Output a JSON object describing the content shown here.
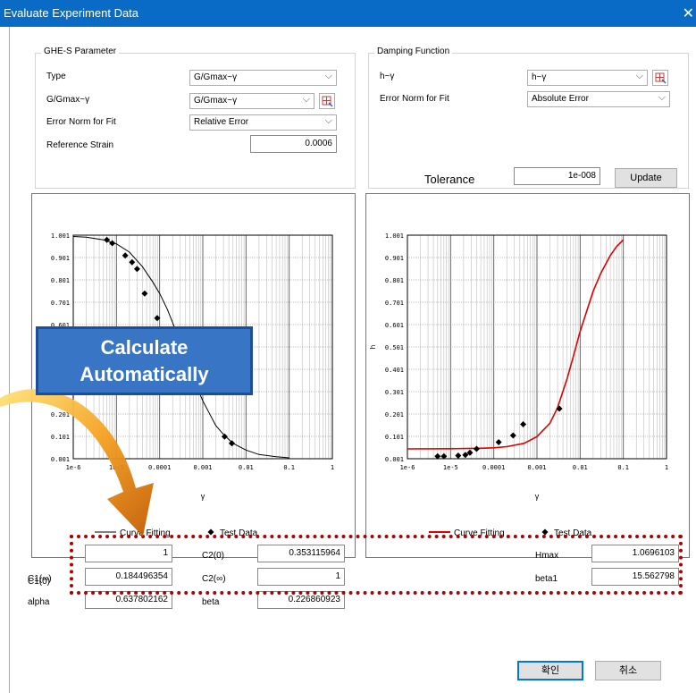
{
  "window": {
    "title": "Evaluate Experiment Data"
  },
  "ghe": {
    "legend": "GHE-S Parameter",
    "type_label": "Type",
    "type_value": "G/Gmax~γ",
    "curve_label": "G/Gmax~γ",
    "curve_value": "G/Gmax~γ",
    "norm_label": "Error Norm for Fit",
    "norm_value": "Relative Error",
    "ref_label": "Reference Strain",
    "ref_value": "0.0006"
  },
  "damping": {
    "legend": "Damping Function",
    "curve_label": "h~γ",
    "curve_value": "h~γ",
    "norm_label": "Error Norm for Fit",
    "norm_value": "Absolute Error"
  },
  "tolerance": {
    "label": "Tolerance",
    "value": "1e-008",
    "update_label": "Update"
  },
  "overlay": {
    "line1": "Calculate",
    "line2": "Automatically"
  },
  "params": {
    "c1_0_label": "C1(0)",
    "c1_0": "1",
    "c1_inf_label": "C1(∞)",
    "c1_inf": "0.184496354",
    "alpha_label": "alpha",
    "alpha": "0.637802162",
    "c2_0_label": "C2(0)",
    "c2_0": "0.353115964",
    "c2_inf_label": "C2(∞)",
    "c2_inf": "1",
    "beta_label": "beta",
    "beta": "0.226860923",
    "hmax_label": "Hmax",
    "hmax": "1.0696103",
    "beta1_label": "beta1",
    "beta1": "15.562798"
  },
  "buttons": {
    "ok": "확인",
    "cancel": "취소"
  },
  "colors": {
    "titlebar": "#0a6bc7",
    "fit_left": "#000000",
    "fit_right": "#e00000",
    "dotted": "#b00000",
    "overlay": "#3876c5"
  },
  "chart_data": [
    {
      "type": "line",
      "x_scale": "log",
      "xlim": [
        1e-06,
        1
      ],
      "ylim": [
        0.001,
        1.001
      ],
      "xlabel": "γ",
      "ylabel": "G/Gmax",
      "ytick_labels": [
        "0.001",
        "0.101",
        "0.201",
        "0.301",
        "0.401",
        "0.501",
        "0.601",
        "0.701",
        "0.801",
        "0.901",
        "1.001"
      ],
      "xtick_labels": [
        "1e-6",
        "1e-5",
        "0.0001",
        "0.001",
        "0.01",
        "0.1",
        "1"
      ],
      "legend": [
        "Curve Fitting",
        "Test Data"
      ],
      "series": [
        {
          "name": "Curve Fitting",
          "x": [
            1e-06,
            2e-06,
            5e-06,
            1e-05,
            2e-05,
            4e-05,
            7e-05,
            0.0001,
            0.00015,
            0.0002,
            0.0003,
            0.0005,
            0.0007,
            0.001,
            0.002,
            0.003,
            0.005,
            0.01,
            0.02,
            0.05,
            0.1
          ],
          "y": [
            0.995,
            0.992,
            0.98,
            0.962,
            0.925,
            0.86,
            0.79,
            0.74,
            0.67,
            0.61,
            0.52,
            0.4,
            0.33,
            0.26,
            0.15,
            0.11,
            0.07,
            0.04,
            0.02,
            0.01,
            0.005
          ]
        },
        {
          "name": "Test Data",
          "x": [
            6e-06,
            8e-06,
            1.6e-05,
            2.3e-05,
            3e-05,
            4.5e-05,
            8.8e-05,
            0.00018,
            0.0032,
            0.0047
          ],
          "y": [
            0.98,
            0.965,
            0.91,
            0.88,
            0.85,
            0.74,
            0.63,
            0.43,
            0.1,
            0.07
          ]
        }
      ]
    },
    {
      "type": "line",
      "x_scale": "log",
      "xlim": [
        1e-06,
        1
      ],
      "ylim": [
        0.001,
        1.001
      ],
      "xlabel": "γ",
      "ylabel": "h",
      "ytick_labels": [
        "0.001",
        "0.101",
        "0.201",
        "0.301",
        "0.401",
        "0.501",
        "0.601",
        "0.701",
        "0.801",
        "0.901",
        "1.001"
      ],
      "xtick_labels": [
        "1e-6",
        "1e-5",
        "0.0001",
        "0.001",
        "0.01",
        "0.1",
        "1"
      ],
      "legend": [
        "Curve Fitting",
        "Test Data"
      ],
      "series": [
        {
          "name": "Curve Fitting",
          "x": [
            1e-06,
            1e-05,
            5e-05,
            0.0001,
            0.0002,
            0.0005,
            0.001,
            0.002,
            0.003,
            0.005,
            0.007,
            0.01,
            0.02,
            0.03,
            0.05,
            0.07,
            0.1
          ],
          "y": [
            0.045,
            0.046,
            0.048,
            0.05,
            0.055,
            0.07,
            0.1,
            0.16,
            0.23,
            0.36,
            0.46,
            0.57,
            0.75,
            0.83,
            0.91,
            0.95,
            0.98
          ]
        },
        {
          "name": "Test Data",
          "x": [
            5e-06,
            7e-06,
            1.5e-05,
            2.2e-05,
            2.8e-05,
            4e-05,
            0.00013,
            0.00028,
            0.00048,
            0.0033
          ],
          "y": [
            0.012,
            0.012,
            0.015,
            0.018,
            0.028,
            0.045,
            0.075,
            0.105,
            0.155,
            0.225
          ]
        }
      ]
    }
  ]
}
